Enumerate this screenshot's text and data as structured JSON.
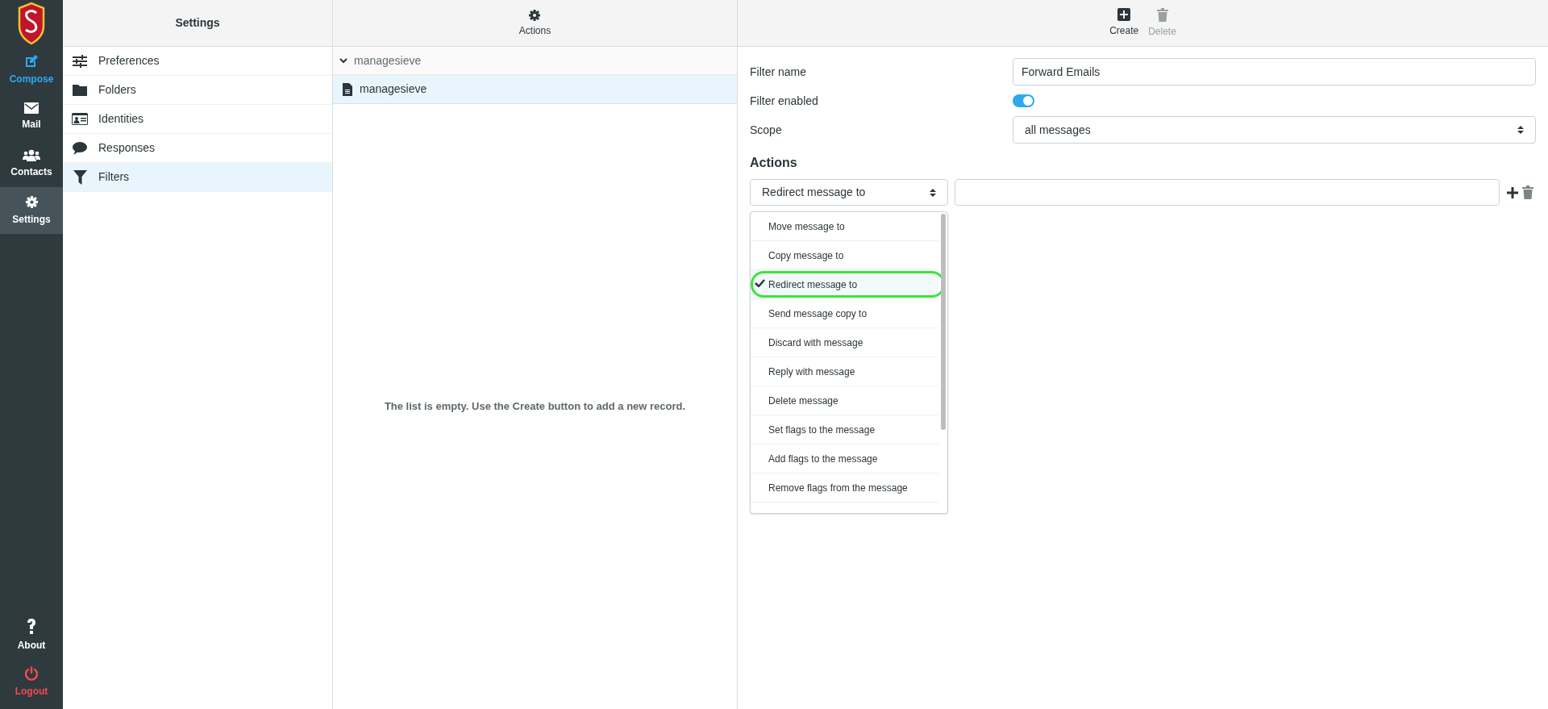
{
  "nav": {
    "items": [
      {
        "label": "Compose",
        "kind": "primary",
        "selected": false
      },
      {
        "label": "Mail",
        "kind": "normal",
        "selected": false
      },
      {
        "label": "Contacts",
        "kind": "normal",
        "selected": false
      },
      {
        "label": "Settings",
        "kind": "normal",
        "selected": true
      }
    ],
    "bottom": [
      {
        "label": "About",
        "kind": "normal"
      },
      {
        "label": "Logout",
        "kind": "danger"
      }
    ]
  },
  "settings": {
    "title": "Settings",
    "items": [
      {
        "label": "Preferences",
        "selected": false
      },
      {
        "label": "Folders",
        "selected": false
      },
      {
        "label": "Identities",
        "selected": false
      },
      {
        "label": "Responses",
        "selected": false
      },
      {
        "label": "Filters",
        "selected": true
      }
    ]
  },
  "middle": {
    "toolbar": {
      "label": "Actions"
    },
    "group": {
      "label": "managesieve",
      "expanded": true
    },
    "sets": [
      {
        "label": "managesieve",
        "selected": true
      }
    ],
    "empty_message": "The list is empty. Use the Create button to add a new record."
  },
  "editor": {
    "toolbar": [
      {
        "label": "Create",
        "disabled": false
      },
      {
        "label": "Delete",
        "disabled": true
      }
    ],
    "filter_name": {
      "label": "Filter name",
      "value": "Forward Emails"
    },
    "filter_enabled": {
      "label": "Filter enabled",
      "on": true
    },
    "scope": {
      "label": "Scope",
      "value": "all messages"
    },
    "actions_heading": "Actions",
    "action": {
      "value": "Redirect message to",
      "options": [
        {
          "label": "Move message to",
          "selected": false
        },
        {
          "label": "Copy message to",
          "selected": false
        },
        {
          "label": "Redirect message to",
          "selected": true
        },
        {
          "label": "Send message copy to",
          "selected": false
        },
        {
          "label": "Discard with message",
          "selected": false
        },
        {
          "label": "Reply with message",
          "selected": false
        },
        {
          "label": "Delete message",
          "selected": false
        },
        {
          "label": "Set flags to the message",
          "selected": false
        },
        {
          "label": "Add flags to the message",
          "selected": false
        },
        {
          "label": "Remove flags from the message",
          "selected": false
        }
      ]
    }
  }
}
